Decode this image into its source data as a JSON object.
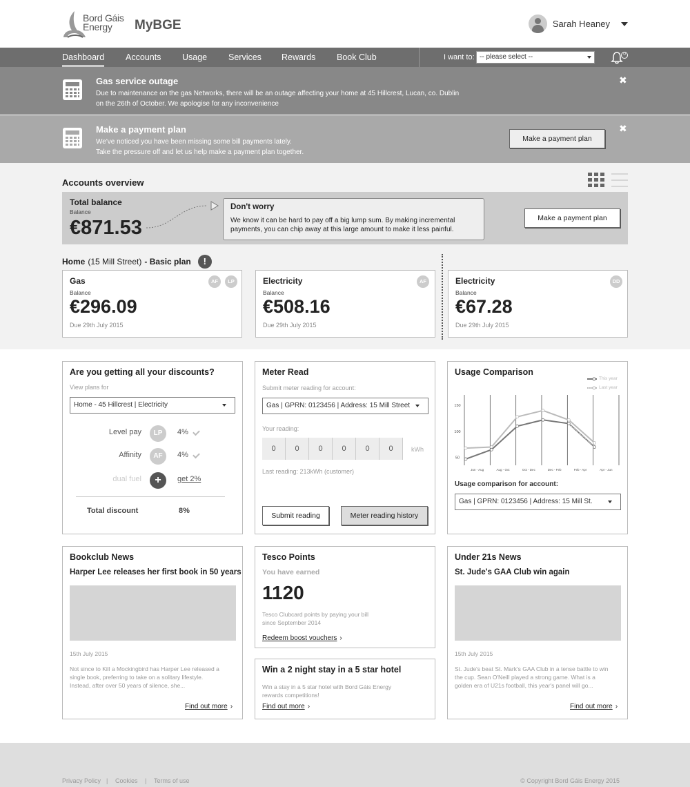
{
  "header": {
    "logo_line1": "Bord Gáis",
    "logo_line2": "Energy",
    "app_name": "MyBGE",
    "user_name": "Sarah Heaney"
  },
  "nav": {
    "items": [
      "Dashboard",
      "Accounts",
      "Usage",
      "Services",
      "Rewards",
      "Book Club"
    ],
    "active": "Dashboard",
    "i_want_label": "I want to:",
    "select_value": "-- please select --",
    "bell_count": "0"
  },
  "alerts": [
    {
      "title": "Gas service outage",
      "line1": "Due to maintenance on the gas Networks, there will be an outage affecting your home at 45 Hillcrest, Lucan, co. Dublin",
      "line2": "on the 26th of October. We apologise for any inconvenience",
      "close": "✖"
    },
    {
      "title": "Make a payment plan",
      "line1": "We've noticed you have been missing some bill payments lately.",
      "line2": "Take the pressure off and let us help make a payment plan together.",
      "button": "Make a payment plan",
      "close": "✖"
    }
  ],
  "overview": {
    "title": "Accounts overview",
    "total": {
      "label": "Total balance",
      "sub": "Balance",
      "amount": "€871.53"
    },
    "worry": {
      "title": "Don't worry",
      "line1": "We know it can be hard to pay off a big lump sum. By making incremental",
      "line2": "payments, you can chip away at this large amount to make it less painful."
    },
    "button": "Make a payment plan",
    "home": {
      "name": "Home",
      "address": "(15 Mill Street)",
      "plan": "- Basic plan",
      "alert": "!"
    },
    "accounts": [
      {
        "title": "Gas",
        "sub": "Balance",
        "amount": "€296.09",
        "due": "Due 29th July 2015",
        "badges": [
          "AF",
          "LP"
        ]
      },
      {
        "title": "Electricity",
        "sub": "Balance",
        "amount": "€508.16",
        "due": "Due 29th July 2015",
        "badges": [
          "AF"
        ]
      },
      {
        "title": "Electricity",
        "sub": "Balance",
        "amount": "€67.28",
        "due": "Due 29th July 2015",
        "badges": [
          "DD"
        ]
      }
    ]
  },
  "discounts": {
    "title": "Are you getting all your discounts?",
    "sub": "View plans for",
    "select": "Home - 45 Hillcrest | Electricity",
    "rows": [
      {
        "label": "Level pay",
        "badge": "LP",
        "pct": "4%"
      },
      {
        "label": "Affinity",
        "badge": "AF",
        "pct": "4%"
      }
    ],
    "dual": {
      "label": "dual fuel",
      "badge": "+",
      "link": "get 2%"
    },
    "total_label": "Total discount",
    "total_value": "8%"
  },
  "meter": {
    "title": "Meter Read",
    "sub": "Submit meter reading for account:",
    "select": "Gas | GPRN: 0123456 | Address: 15 Mill Street",
    "reading_label": "Your reading:",
    "digits": [
      "0",
      "0",
      "0",
      "0",
      "0",
      "0"
    ],
    "unit": "kWh",
    "last": "Last reading: 213kWh (customer)",
    "submit": "Submit reading",
    "history": "Meter reading history"
  },
  "usage": {
    "title": "Usage Comparison",
    "legend_this": "This year",
    "legend_last": "Last year",
    "account_label": "Usage comparison for account:",
    "select": "Gas | GPRN: 0123456 | Address: 15 Mill St."
  },
  "chart_data": {
    "type": "line",
    "categories": [
      "Jun - Aug",
      "Aug - Oct",
      "Oct - Dec",
      "Dec - Feb",
      "Feb - Apr",
      "Apr - Jun"
    ],
    "series": [
      {
        "name": "This year",
        "values": [
          47,
          65,
          110,
          122,
          115,
          70
        ]
      },
      {
        "name": "Last year",
        "values": [
          68,
          70,
          128,
          140,
          122,
          78
        ]
      }
    ],
    "yticks": [
      50,
      100,
      150
    ],
    "ylim": [
      35,
      170
    ],
    "colors": {
      "this_year": "#777777",
      "last_year": "#bbbbbb"
    }
  },
  "bookclub": {
    "title": "Bookclub News",
    "headline": "Harper Lee releases her first book in 50 years",
    "date": "15th July 2015",
    "text1": "Not since to Kill a Mockingbird has Harper Lee released a",
    "text2": "single book, preferring to take on a solitary lifestyle.",
    "text3": "Instead, after over 50 years of silence, she...",
    "link": "Find out more"
  },
  "tesco": {
    "title": "Tesco Points",
    "earned": "You have earned",
    "points": "1120",
    "line1": "Tesco Clubcard points by paying your bill",
    "line2": "since September 2014",
    "link": "Redeem boost vouchers"
  },
  "hotel": {
    "title": "Win a 2 night stay in a 5 star hotel",
    "line1": "Win a stay in a 5 star hotel with Bord Gáis Energy",
    "line2": "rewards competitions!",
    "link": "Find out more"
  },
  "under21": {
    "title": "Under 21s News",
    "headline": "St. Jude's GAA Club win again",
    "date": "15th July 2015",
    "text1": "St. Jude's beat St. Mark's GAA Club in a tense battle to win",
    "text2": "the cup. Sean O'Neill played a strong game. What is a",
    "text3": "golden era of U21s football, this year's panel will go...",
    "link": "Find out more"
  },
  "footer": {
    "links": [
      "Privacy Policy",
      "|",
      "Cookies",
      "|",
      "Terms of use"
    ],
    "copyright": "© Copyright Bord Gáis Energy 2015"
  }
}
